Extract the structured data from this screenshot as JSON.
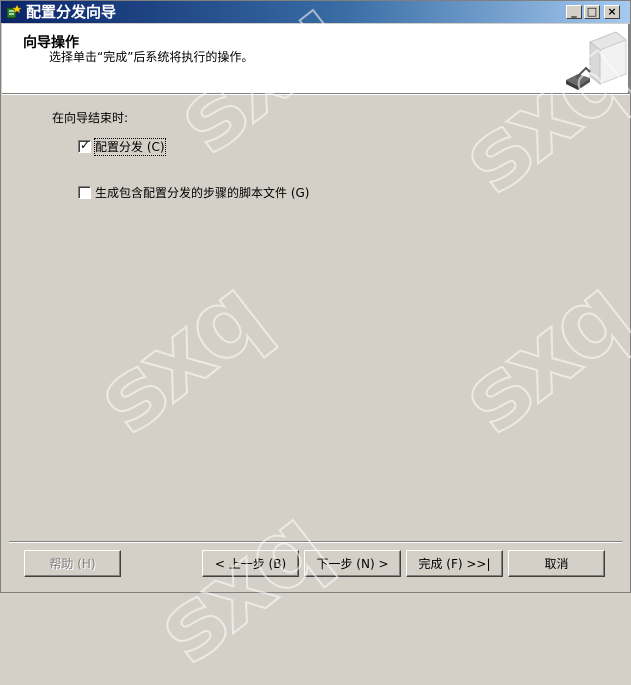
{
  "window": {
    "title": "配置分发向导",
    "controls": {
      "minimize": "_",
      "maximize": "□",
      "close": "×"
    }
  },
  "header": {
    "title": "向导操作",
    "subtitle": "选择单击“完成”后系统将执行的操作。"
  },
  "body": {
    "group_label": "在向导结束时:",
    "options": [
      {
        "label": "配置分发 (C)",
        "checked": true
      },
      {
        "label": "生成包含配置分发的步骤的脚本文件 (G)",
        "checked": false
      }
    ]
  },
  "footer": {
    "help": "帮助 (H)",
    "back": "< 上一步 (B)",
    "next": "下一步 (N) >",
    "finish": "完成 (F) >>|",
    "cancel": "取消"
  },
  "watermark": "sxq",
  "colors": {
    "titlebar_start": "#0a246a",
    "titlebar_end": "#a6caf0",
    "dialog_bg": "#d4d0c8",
    "header_bg": "#ffffff"
  }
}
